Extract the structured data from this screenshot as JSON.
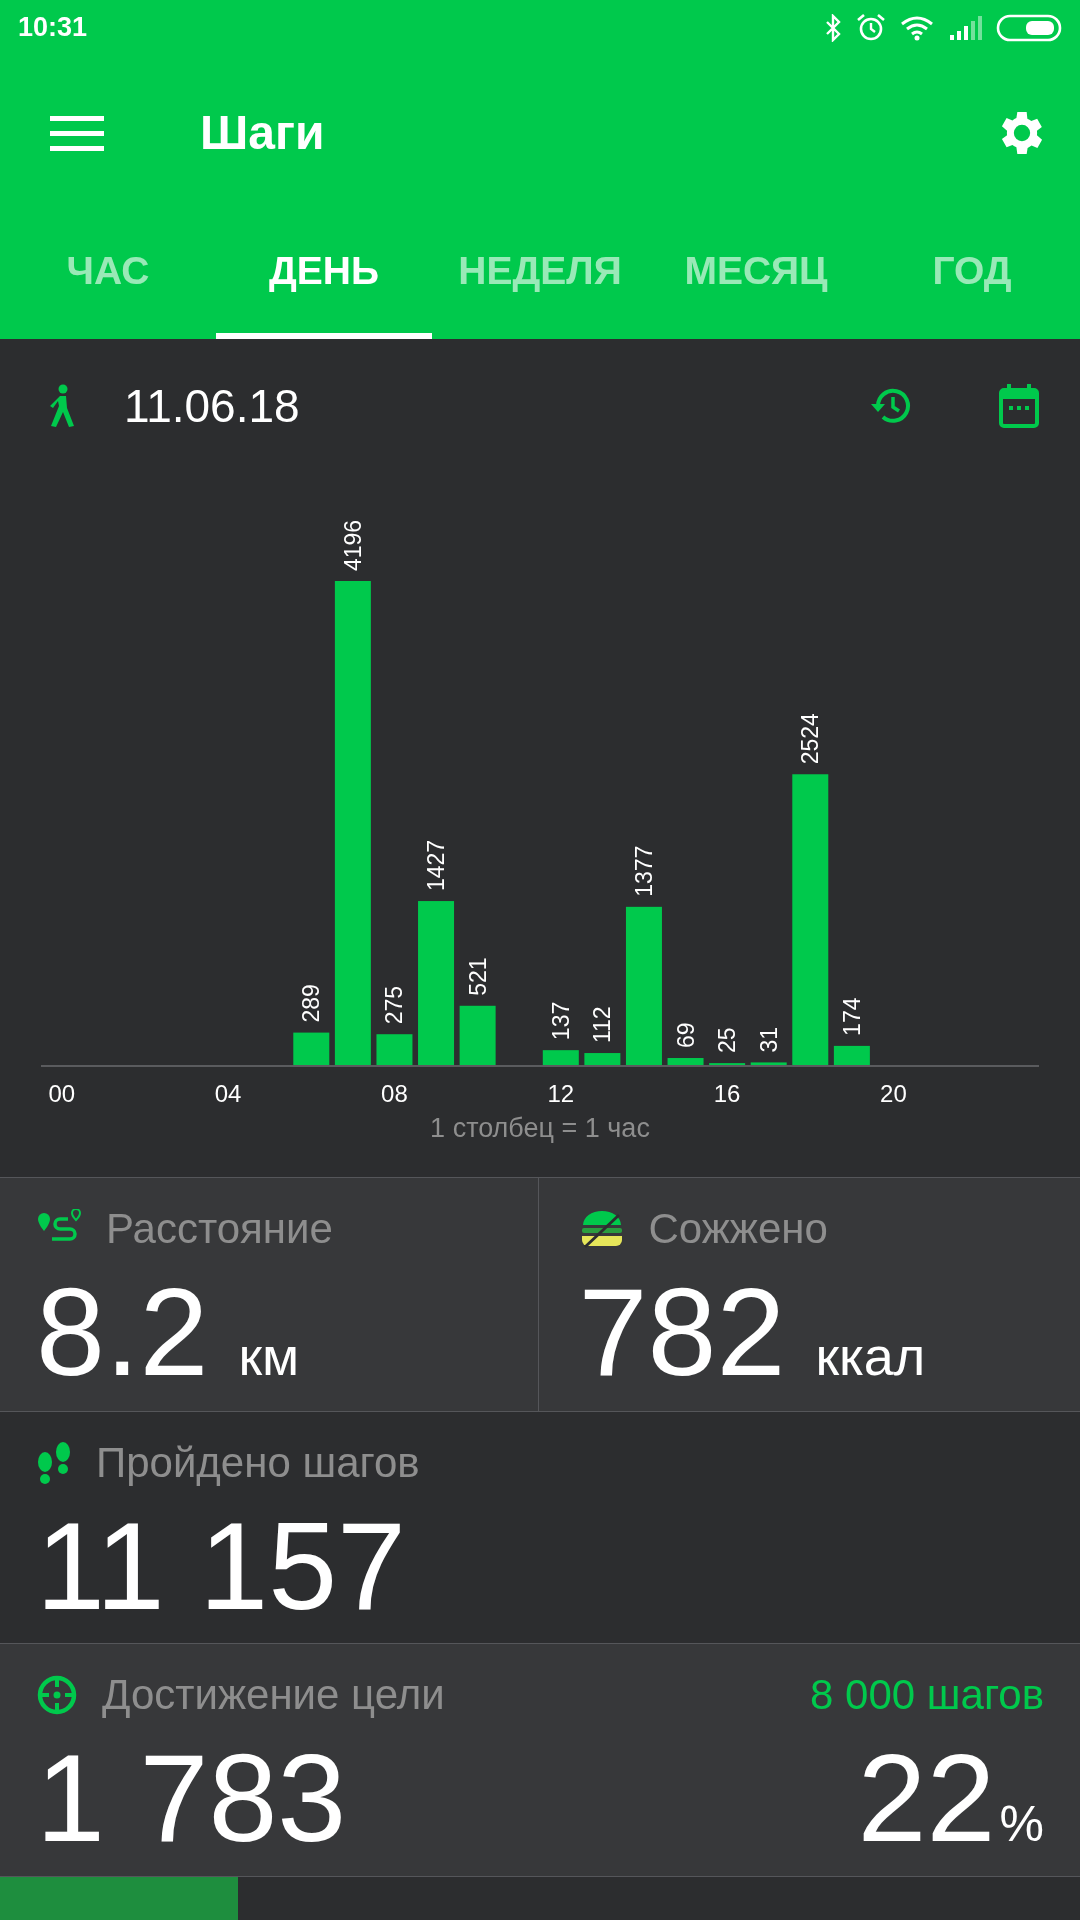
{
  "status_bar": {
    "time": "10:31"
  },
  "toolbar": {
    "title": "Шаги"
  },
  "tabs": [
    {
      "label": "ЧАС",
      "selected": false
    },
    {
      "label": "ДЕНЬ",
      "selected": true
    },
    {
      "label": "НЕДЕЛЯ",
      "selected": false
    },
    {
      "label": "МЕСЯЦ",
      "selected": false
    },
    {
      "label": "ГОД",
      "selected": false
    }
  ],
  "date": "11.06.18",
  "chart_data": {
    "type": "bar",
    "x": [
      6,
      7,
      8,
      9,
      10,
      12,
      13,
      14,
      15,
      16,
      17,
      18,
      19
    ],
    "values": [
      289,
      4196,
      275,
      1427,
      521,
      137,
      112,
      1377,
      69,
      25,
      31,
      2524,
      174
    ],
    "xticks": [
      {
        "value": 0,
        "label": "00"
      },
      {
        "value": 4,
        "label": "04"
      },
      {
        "value": 8,
        "label": "08"
      },
      {
        "value": 12,
        "label": "12"
      },
      {
        "value": 16,
        "label": "16"
      },
      {
        "value": 20,
        "label": "20"
      }
    ],
    "xlim": [
      -0.5,
      23.5
    ],
    "data_labels": true
  },
  "chart_caption": "1 столбец = 1 час",
  "stats": [
    {
      "kind": "distance",
      "label": "Расстояние",
      "value": "8.2",
      "unit": "км"
    },
    {
      "kind": "calories",
      "label": "Сожжено",
      "value": "782",
      "unit": "ккал"
    },
    {
      "kind": "steps",
      "label": "Пройдено шагов",
      "value": "11 157"
    }
  ],
  "goal": {
    "label": "Достижение цели",
    "target": "8 000 шагов",
    "value": "1 783",
    "percent": "22",
    "percent_sign": "%",
    "level": 0.22
  }
}
